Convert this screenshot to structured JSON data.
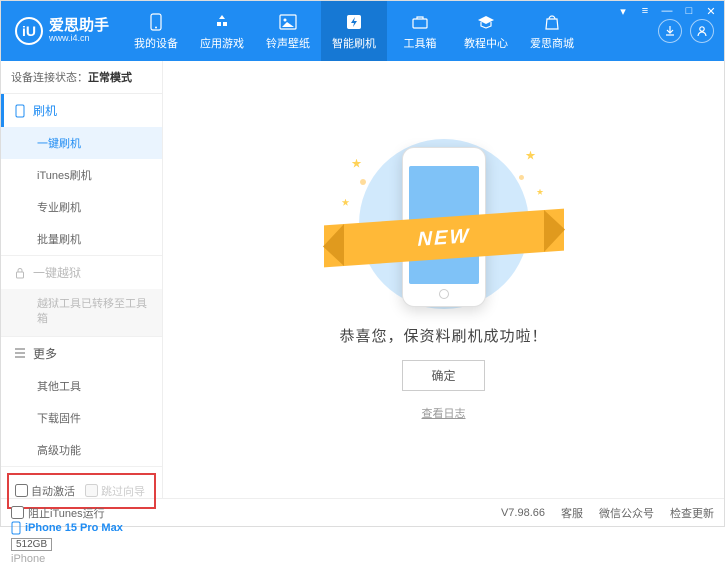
{
  "logo": {
    "badge": "iU",
    "title": "爱思助手",
    "url": "www.i4.cn"
  },
  "nav": [
    {
      "label": "我的设备"
    },
    {
      "label": "应用游戏"
    },
    {
      "label": "铃声壁纸"
    },
    {
      "label": "智能刷机"
    },
    {
      "label": "工具箱"
    },
    {
      "label": "教程中心"
    },
    {
      "label": "爱思商城"
    }
  ],
  "status": {
    "label": "设备连接状态：",
    "value": "正常模式"
  },
  "sidebar": {
    "flash": {
      "header": "刷机",
      "items": [
        "一键刷机",
        "iTunes刷机",
        "专业刷机",
        "批量刷机"
      ]
    },
    "jailbreak": {
      "header": "一键越狱",
      "note": "越狱工具已转移至工具箱"
    },
    "more": {
      "header": "更多",
      "items": [
        "其他工具",
        "下载固件",
        "高级功能"
      ]
    }
  },
  "checkboxes": {
    "auto_activate": "自动激活",
    "skip_guide": "跳过向导"
  },
  "device": {
    "name": "iPhone 15 Pro Max",
    "storage": "512GB",
    "type": "iPhone"
  },
  "main": {
    "ribbon": "NEW",
    "success": "恭喜您，保资料刷机成功啦！",
    "ok": "确定",
    "log": "查看日志"
  },
  "footer": {
    "block_itunes": "阻止iTunes运行",
    "version": "V7.98.66",
    "links": [
      "客服",
      "微信公众号",
      "检查更新"
    ]
  }
}
